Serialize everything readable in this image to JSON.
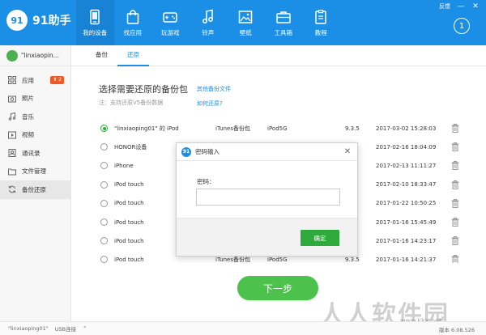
{
  "app": {
    "brand_mark": "91",
    "brand_name": "91助手",
    "feedback": "反馈",
    "min_glyph": "—",
    "close_glyph": "✕",
    "notification_count": "1"
  },
  "nav": {
    "items": [
      {
        "label": "我的设备",
        "icon": "phone-icon",
        "active": true
      },
      {
        "label": "找应用",
        "icon": "shopping-bag-icon",
        "active": false
      },
      {
        "label": "玩游戏",
        "icon": "gamepad-icon",
        "active": false
      },
      {
        "label": "铃声",
        "icon": "music-note-icon",
        "active": false
      },
      {
        "label": "壁纸",
        "icon": "image-icon",
        "active": false
      },
      {
        "label": "工具箱",
        "icon": "toolbox-icon",
        "active": false
      },
      {
        "label": "教程",
        "icon": "clipboard-icon",
        "active": false
      }
    ]
  },
  "device": {
    "name": "\"linxiaopin..."
  },
  "tabs": [
    {
      "label": "备份",
      "active": false
    },
    {
      "label": "还原",
      "active": true
    }
  ],
  "sidebar": {
    "items": [
      {
        "label": "应用",
        "icon": "apps-grid-icon",
        "badge": "2",
        "active": false
      },
      {
        "label": "照片",
        "icon": "camera-icon",
        "badge": "",
        "active": false
      },
      {
        "label": "音乐",
        "icon": "music-icon",
        "badge": "",
        "active": false
      },
      {
        "label": "视频",
        "icon": "video-icon",
        "badge": "",
        "active": false
      },
      {
        "label": "通讯录",
        "icon": "contacts-icon",
        "badge": "",
        "active": false
      },
      {
        "label": "文件管理",
        "icon": "folder-icon",
        "badge": "",
        "active": false
      },
      {
        "label": "备份还原",
        "icon": "sync-icon",
        "badge": "",
        "active": true
      }
    ]
  },
  "main": {
    "title": "选择需要还原的备份包",
    "other_backup_link": "其他备份文件",
    "note": "注：支持还原V5备份数据",
    "how_to_link": "如何还原?",
    "next_button": "下一步"
  },
  "backups": {
    "rows": [
      {
        "name": "\"linxiaoping01\" 的 iPod",
        "type": "iTunes备份包",
        "model": "iPod5G",
        "version": "9.3.5",
        "date": "2017-03-02 15:28:03",
        "checked": true
      },
      {
        "name": "HONOR设备",
        "type": "",
        "model": "",
        "version": "",
        "date": "2017-02-16 18:04:09",
        "checked": false
      },
      {
        "name": "iPhone",
        "type": "",
        "model": "",
        "version": "",
        "date": "2017-02-13 11:11:27",
        "checked": false
      },
      {
        "name": "iPod touch",
        "type": "",
        "model": "",
        "version": "",
        "date": "2017-02-10 18:33:47",
        "checked": false
      },
      {
        "name": "iPod touch",
        "type": "",
        "model": "",
        "version": "",
        "date": "2017-01-22 10:50:25",
        "checked": false
      },
      {
        "name": "iPod touch",
        "type": "",
        "model": "",
        "version": "",
        "date": "2017-01-16 15:45:49",
        "checked": false
      },
      {
        "name": "iPod touch",
        "type": "",
        "model": "",
        "version": "",
        "date": "2017-01-16 14:23:17",
        "checked": false
      },
      {
        "name": "iPod touch",
        "type": "iTunes备份包",
        "model": "iPod5G",
        "version": "9.3.5",
        "date": "2017-01-16 14:21:37",
        "checked": false
      }
    ]
  },
  "dialog": {
    "title": "密码输入",
    "close_glyph": "✕",
    "password_label": "密码：",
    "password_value": "",
    "ok_button": "确定"
  },
  "statusbar": {
    "device": "\"linxiaoping01\"",
    "connection": "USB连接",
    "version": "版本 6.08.526"
  },
  "watermark": {
    "text": "人人软件园",
    "url": "www.kkx.net"
  },
  "colors": {
    "primary": "#1b8fe6",
    "success": "#2eaa3c",
    "next_button": "#4cc24c",
    "badge": "#f05a28"
  }
}
